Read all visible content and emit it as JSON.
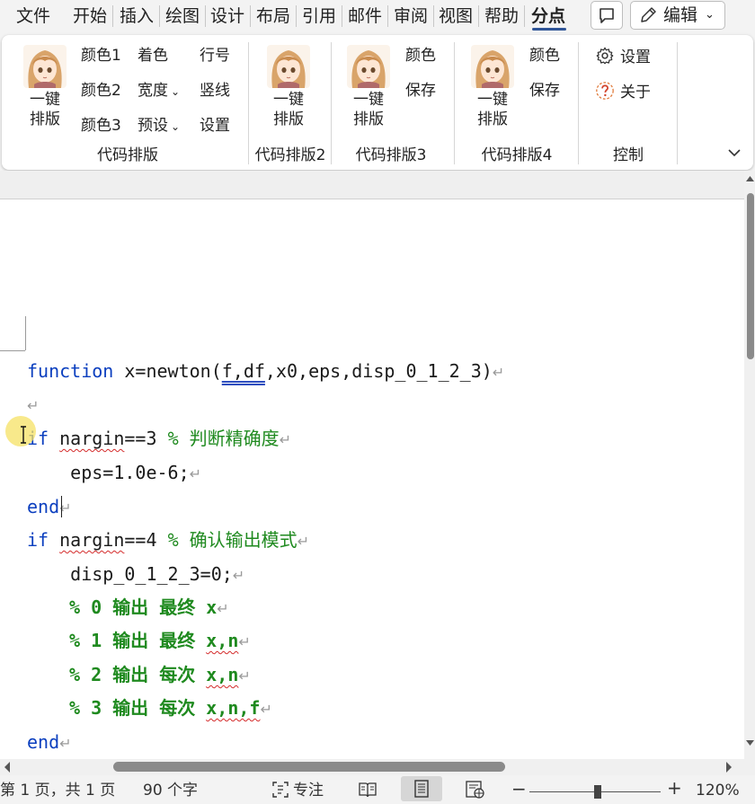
{
  "menu": {
    "tabs": [
      "文件",
      "开始",
      "插入",
      "绘图",
      "设计",
      "布局",
      "引用",
      "邮件",
      "审阅",
      "视图",
      "帮助",
      "分点"
    ],
    "edit_label": "编辑"
  },
  "ribbon": {
    "group1": {
      "one_key_top": "一键",
      "one_key_bottom": "排版",
      "color1": "颜色1",
      "color2": "颜色2",
      "color3": "颜色3",
      "coloring": "着色",
      "width": "宽度",
      "preset": "预设",
      "line_no": "行号",
      "vertical_line": "竖线",
      "settings": "设置",
      "label": "代码排版"
    },
    "group2": {
      "one_key_top": "一键",
      "one_key_bottom": "排版",
      "label": "代码排版2"
    },
    "group3": {
      "one_key_top": "一键",
      "one_key_bottom": "排版",
      "color": "颜色",
      "save": "保存",
      "label": "代码排版3"
    },
    "group4": {
      "one_key_top": "一键",
      "one_key_bottom": "排版",
      "color": "颜色",
      "save": "保存",
      "label": "代码排版4"
    },
    "control": {
      "settings": "设置",
      "about": "关于",
      "label": "控制"
    }
  },
  "code": {
    "l1_kw": "function",
    "l1_a": " x=newton(",
    "l1_b": "f,df",
    "l1_c": ",x0,eps,disp_0_1_2_3)",
    "l3_kw": "if",
    "l3_var": "nargin",
    "l3_rest": "==3 ",
    "l3_comment": "% 判断精确度",
    "l4": "    eps=1.0e-6;",
    "l5_kw": "end",
    "l6_kw": "if",
    "l6_var": "nargin",
    "l6_rest": "==4 ",
    "l6_comment": "% 确认输出模式",
    "l7": "    disp_0_1_2_3=0;",
    "l8_a": "% 0 输出 最终 ",
    "l8_b": "x",
    "l9_a": "% 1 输出 最终 ",
    "l9_b": "x,n",
    "l10_a": "% 2 输出 每次 ",
    "l10_b": "x,n",
    "l11_a": "% 3 输出 每次 ",
    "l11_b": "x,n,f",
    "l12_kw": "end",
    "pilcrow": "↵"
  },
  "status": {
    "page": "第 1 页，共 1 页",
    "words": "90 个字",
    "focus": "专注",
    "zoom_minus": "−",
    "zoom_plus": "+",
    "zoom": "120%"
  }
}
